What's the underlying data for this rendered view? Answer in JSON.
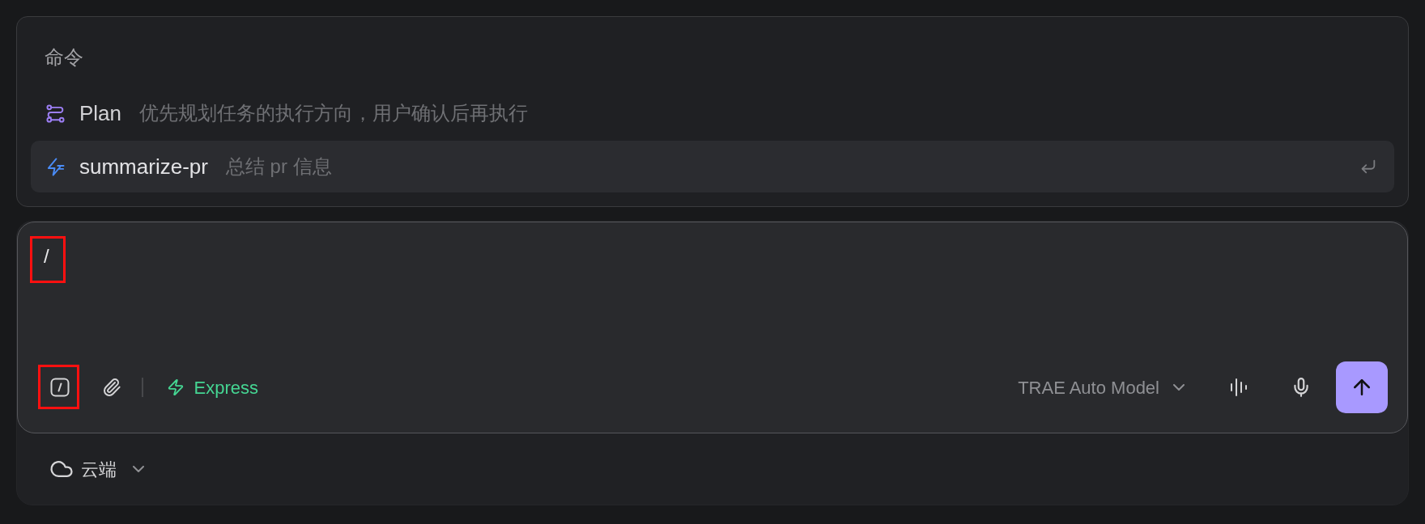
{
  "command_panel": {
    "title": "命令",
    "items": [
      {
        "kind": "plan",
        "name": "Plan",
        "description": "优先规划任务的执行方向，用户确认后再执行",
        "selected": false
      },
      {
        "kind": "skill",
        "name": "summarize-pr",
        "description": "总结 pr 信息",
        "selected": true
      }
    ]
  },
  "composer": {
    "value": "/",
    "highlighted": true,
    "tools": [
      {
        "kind": "slash",
        "highlighted": true
      },
      {
        "kind": "attach",
        "highlighted": false
      }
    ],
    "mode": {
      "label": "Express"
    },
    "model": {
      "label": "TRAE Auto Model"
    }
  },
  "footer": {
    "environment": {
      "label": "云端"
    }
  }
}
